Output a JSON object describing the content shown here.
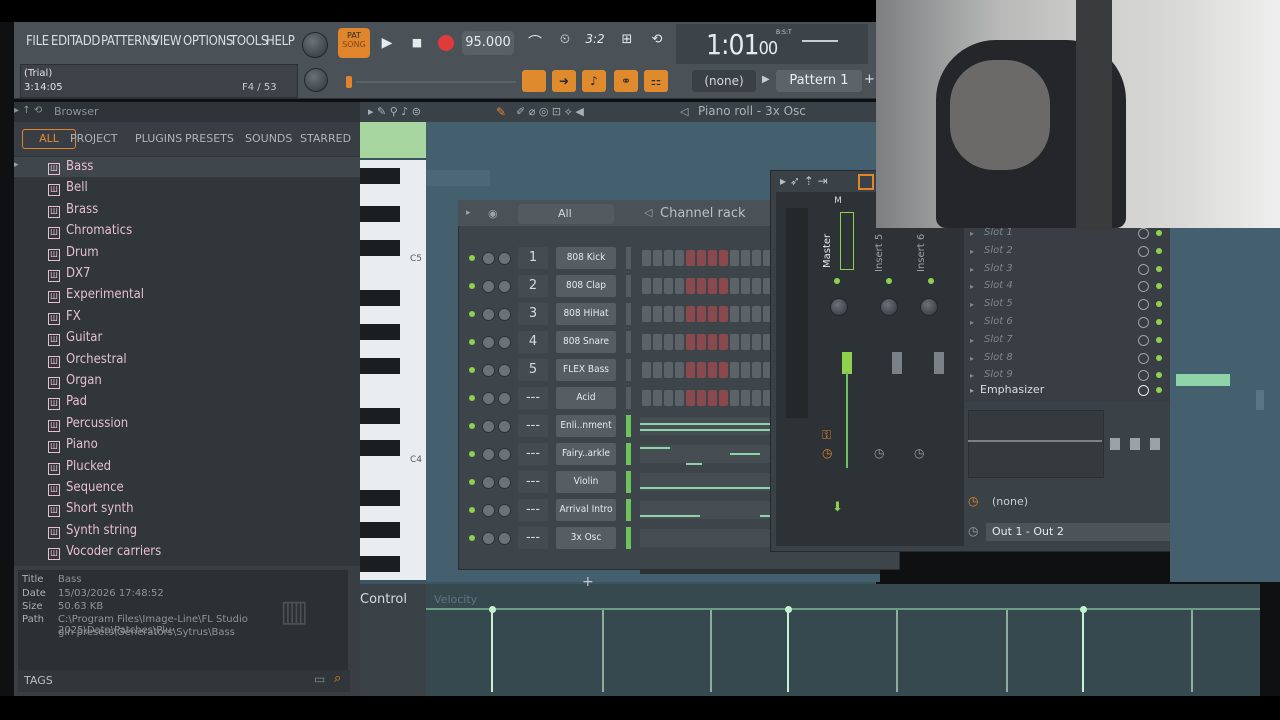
{
  "menu": [
    "FILE",
    "EDIT",
    "ADD",
    "PATTERNS",
    "VIEW",
    "OPTIONS",
    "TOOLS",
    "HELP"
  ],
  "transport": {
    "pat_label": "PAT",
    "song_label": "SONG",
    "tempo": "95.000",
    "time_main": "1:01",
    "time_sub": "00",
    "time_unit": "B:S:T"
  },
  "hint": {
    "line1": "(Trial)",
    "line2": "3:14:05",
    "counter": "F4 / 53"
  },
  "pattern": {
    "none_label": "(none)",
    "pattern_label": "Pattern 1",
    "plus": "+"
  },
  "browser": {
    "title": "Browser",
    "tabs": [
      "ALL",
      "PROJECT",
      "PLUGINS",
      "PRESETS",
      "SOUNDS",
      "STARRED"
    ],
    "items": [
      "Bass",
      "Bell",
      "Brass",
      "Chromatics",
      "Drum",
      "DX7",
      "Experimental",
      "FX",
      "Guitar",
      "Orchestral",
      "Organ",
      "Pad",
      "Percussion",
      "Piano",
      "Plucked",
      "Sequence",
      "Short synth",
      "Synth string",
      "Vocoder carriers"
    ],
    "item_icon": "Ш",
    "info": {
      "title_label": "Title",
      "title": "Bass",
      "date_label": "Date",
      "date": "15/03/2026 17:48:52",
      "size_label": "Size",
      "size": "50.63 KB",
      "path_label": "Path",
      "path1": "C:\\Program Files\\Image-Line\\FL Studio 2025\\Data\\Patches\\Plu-",
      "path2": "gin presets\\Generators\\Sytrus\\Bass"
    },
    "tags_label": "TAGS"
  },
  "pianoroll": {
    "title": "Piano roll - 3x Osc",
    "bar_marker": "3",
    "c5": "C5",
    "c4": "C4",
    "control_label": "Control",
    "velocity_label": "Velocity"
  },
  "channelrack": {
    "filter": "All",
    "title": "Channel rack",
    "channels": [
      {
        "num": "1",
        "name": "808 Kick"
      },
      {
        "num": "2",
        "name": "808 Clap"
      },
      {
        "num": "3",
        "name": "808 HiHat"
      },
      {
        "num": "4",
        "name": "808 Snare"
      },
      {
        "num": "5",
        "name": "FLEX Bass"
      },
      {
        "num": "---",
        "name": "Acid"
      },
      {
        "num": "---",
        "name": "Enli..nment"
      },
      {
        "num": "---",
        "name": "Fairy..arkle"
      },
      {
        "num": "---",
        "name": "Violin"
      },
      {
        "num": "---",
        "name": "Arrival Intro"
      },
      {
        "num": "---",
        "name": "3x Osc"
      }
    ],
    "add": "+"
  },
  "mixer": {
    "master_label": "Master",
    "m_label": "M",
    "insert5": "Insert 5",
    "insert6": "Insert 6",
    "slots": [
      "Slot 1",
      "Slot 2",
      "Slot 3",
      "Slot 4",
      "Slot 5",
      "Slot 6",
      "Slot 7",
      "Slot 8",
      "Slot 9"
    ],
    "emphasizer": "Emphasizer",
    "none_label": "(none)",
    "output": "Out 1 - Out 2"
  },
  "colors": {
    "accent": "#e0852b",
    "led_green": "#8fd14f",
    "note_green": "#c8f1d4",
    "step_red": "#8a4a4d"
  }
}
